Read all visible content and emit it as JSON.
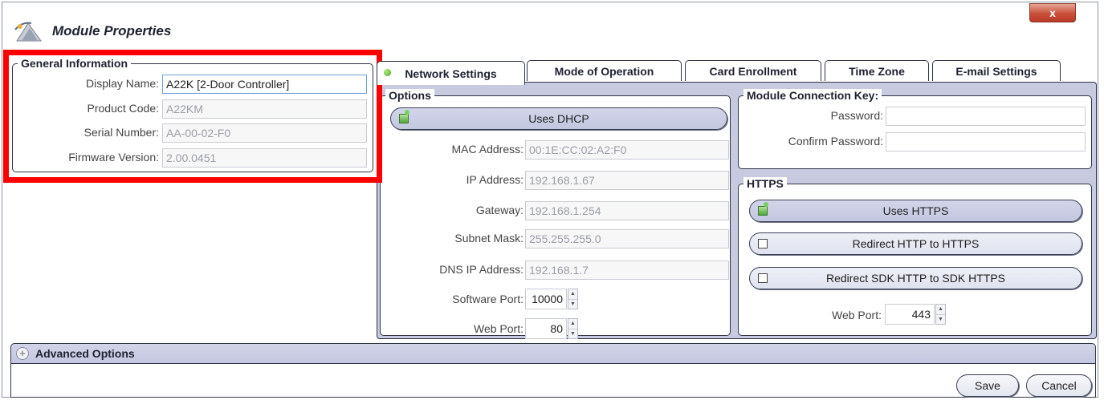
{
  "window": {
    "title": "Module Properties",
    "close_label": "x"
  },
  "general": {
    "legend": "General Information",
    "display_name_label": "Display Name:",
    "display_name_value": "A22K [2-Door Controller]",
    "product_code_label": "Product Code:",
    "product_code_value": "A22KM",
    "serial_number_label": "Serial Number:",
    "serial_number_value": "AA-00-02-F0",
    "firmware_label": "Firmware Version:",
    "firmware_value": "2.00.0451"
  },
  "tabs": [
    {
      "label": "Network Settings",
      "selected": true
    },
    {
      "label": "Mode of Operation",
      "selected": false
    },
    {
      "label": "Card Enrollment",
      "selected": false
    },
    {
      "label": "Time Zone",
      "selected": false
    },
    {
      "label": "E-mail Settings",
      "selected": false
    }
  ],
  "options": {
    "legend": "Options",
    "dhcp_label": "Uses DHCP",
    "dhcp_checked": true,
    "mac_label": "MAC Address:",
    "mac_value": "00:1E:CC:02:A2:F0",
    "ip_label": "IP Address:",
    "ip_value": "192.168.1.67",
    "gateway_label": "Gateway:",
    "gateway_value": "192.168.1.254",
    "subnet_label": "Subnet Mask:",
    "subnet_value": "255.255.255.0",
    "dns_label": "DNS IP Address:",
    "dns_value": "192.168.1.7",
    "software_port_label": "Software Port:",
    "software_port_value": "10000",
    "web_port_label": "Web Port:",
    "web_port_value": "80"
  },
  "connection_key": {
    "legend": "Module Connection Key:",
    "password_label": "Password:",
    "password_value": "",
    "confirm_label": "Confirm Password:",
    "confirm_value": ""
  },
  "https": {
    "legend": "HTTPS",
    "uses_https_label": "Uses HTTPS",
    "uses_https_checked": true,
    "redirect_label": "Redirect HTTP to HTTPS",
    "redirect_checked": false,
    "redirect_sdk_label": "Redirect SDK HTTP to SDK HTTPS",
    "redirect_sdk_checked": false,
    "web_port_label": "Web Port:",
    "web_port_value": "443"
  },
  "advanced": {
    "label": "Advanced Options",
    "expand_symbol": "+"
  },
  "footer": {
    "save_label": "Save",
    "cancel_label": "Cancel"
  },
  "colors": {
    "highlight": "#ff0000",
    "tab_panel": "#c8cbe0",
    "check_green": "#4fa83b"
  }
}
